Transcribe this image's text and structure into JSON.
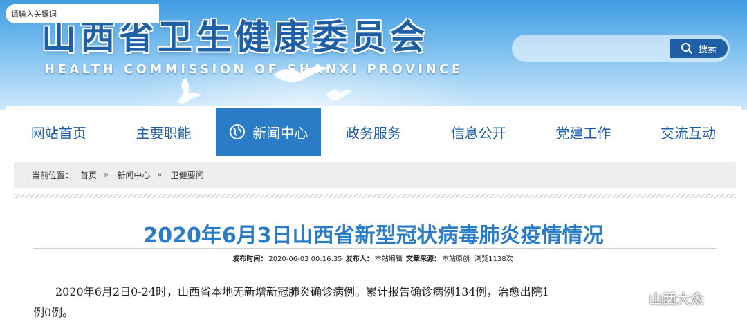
{
  "header": {
    "title": "山西省卫生健康委员会",
    "subtitle": "HEALTH COMMISSION OF SHANXI PROVINCE"
  },
  "search": {
    "placeholder": "请输入关键词",
    "button_label": "搜索",
    "button_icon": "search-icon"
  },
  "nav": {
    "items": [
      {
        "label": "网站首页",
        "active": false
      },
      {
        "label": "主要职能",
        "active": false
      },
      {
        "label": "新闻中心",
        "active": true,
        "icon": "globe-icon"
      },
      {
        "label": "政务服务",
        "active": false
      },
      {
        "label": "信息公开",
        "active": false
      },
      {
        "label": "党建工作",
        "active": false
      },
      {
        "label": "交流互动",
        "active": false
      }
    ],
    "active_color": "#2a7cc6",
    "text_color": "#1f5fa6"
  },
  "breadcrumb": {
    "prefix": "当前位置：",
    "items": [
      "首页",
      "新闻中心",
      "卫健要闻"
    ],
    "separator": "»"
  },
  "article": {
    "title": "2020年6月3日山西省新型冠状病毒肺炎疫情情况",
    "meta": {
      "publish_time_label": "发布时间：",
      "publish_time": "2020-06-03 00:16:35",
      "publisher_label": "发布人：",
      "publisher": "本站编辑",
      "source_label": "文章来源：",
      "source": "本站原创",
      "views": "浏览1138次"
    },
    "body_line1": "2020年6月2日0-24时，山西省本地无新增新冠肺炎确诊病例。累计报告确诊病例134例，治愈出院1",
    "body_line2": "例0例。"
  },
  "watermark": {
    "text": "山西大众",
    "icon": "wechat-icon"
  },
  "colors": {
    "brand_blue": "#1f5fa6",
    "accent_blue": "#2a7cc6"
  }
}
